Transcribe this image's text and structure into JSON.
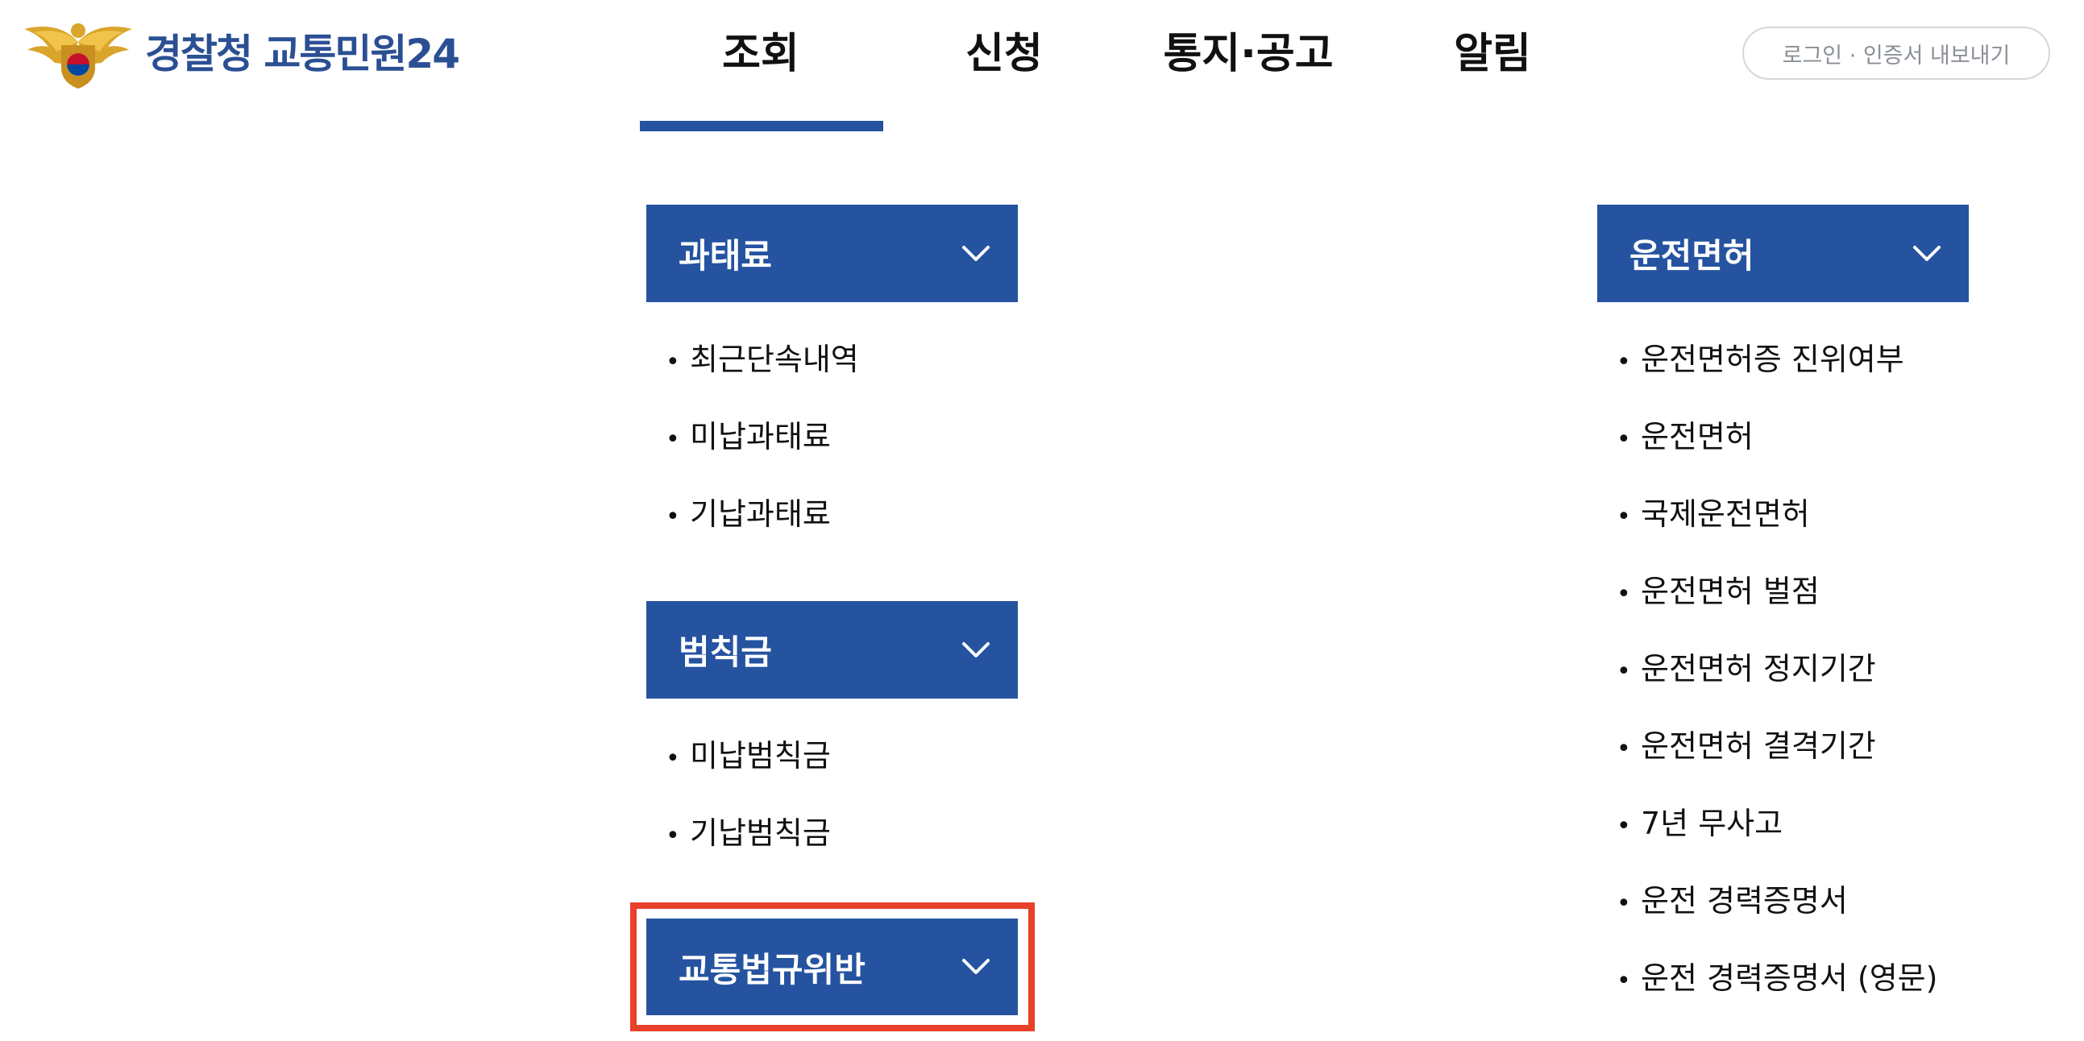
{
  "header": {
    "logo_text": "경찰청 교통민원24",
    "nav_tabs": [
      {
        "label": "조회",
        "active": true
      },
      {
        "label": "신청",
        "active": false
      },
      {
        "label": "통지·공고",
        "active": false
      },
      {
        "label": "알림",
        "active": false
      }
    ],
    "util_button": "로그인  · 인증서 내보내기"
  },
  "colors": {
    "brand_blue": "#2553a0",
    "highlight_red": "#e8402a"
  },
  "menu": {
    "penalty": {
      "title": "과태료",
      "items": [
        "최근단속내역",
        "미납과태료",
        "기납과태료"
      ]
    },
    "fine": {
      "title": "범칙금",
      "items": [
        "미납범칙금",
        "기납범칙금"
      ]
    },
    "violation": {
      "title": "교통법규위반",
      "highlighted": true
    },
    "license": {
      "title": "운전면허",
      "items": [
        "운전면허증 진위여부",
        "운전면허",
        "국제운전면허",
        "운전면허 벌점",
        "운전면허 정지기간",
        "운전면허 결격기간",
        "7년 무사고",
        "운전 경력증명서",
        "운전 경력증명서 (영문)"
      ]
    }
  },
  "bullet": "•",
  "icons": {
    "logo": "police-emblem-icon",
    "expand": "chevron-down-icon"
  }
}
